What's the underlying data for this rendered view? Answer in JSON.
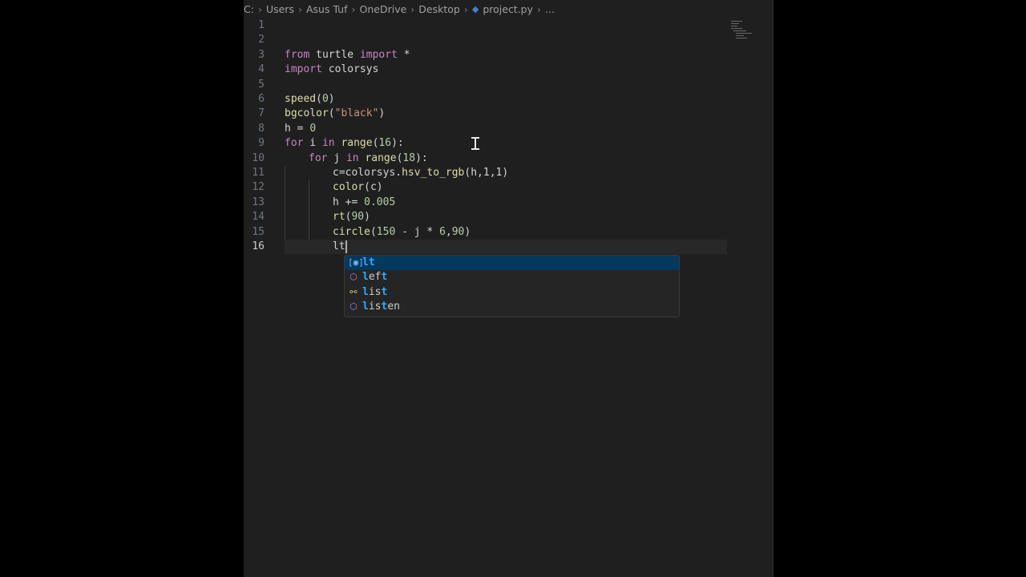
{
  "breadcrumb": {
    "parts": [
      "C:",
      "Users",
      "Asus Tuf",
      "OneDrive",
      "Desktop"
    ],
    "file": "project.py",
    "ellipsis": "..."
  },
  "gutter": {
    "line_numbers": [
      "1",
      "2",
      "3",
      "4",
      "5",
      "6",
      "7",
      "8",
      "9",
      "10",
      "11",
      "12",
      "13",
      "14",
      "15",
      "16"
    ],
    "active_line": "16"
  },
  "code": {
    "l3_kw1": "from",
    "l3_mod": " turtle ",
    "l3_kw2": "import",
    "l3_rest": " *",
    "l4_kw": "import",
    "l4_mod": " colorsys",
    "l6_fn": "speed",
    "l6_open": "(",
    "l6_num": "0",
    "l6_close": ")",
    "l7_fn": "bgcolor",
    "l7_open": "(",
    "l7_str": "\"black\"",
    "l7_close": ")",
    "l8_var": "h",
    "l8_op": " = ",
    "l8_num": "0",
    "l9_kw1": "for",
    "l9_var": " i ",
    "l9_kw2": "in",
    "l9_fn": " range",
    "l9_open": "(",
    "l9_num": "16",
    "l9_close": "):",
    "l10_kw1": "for",
    "l10_var": " j ",
    "l10_kw2": "in",
    "l10_fn": " range",
    "l10_open": "(",
    "l10_num": "18",
    "l10_close": "):",
    "l11_var": "c",
    "l11_op": "=",
    "l11_mod": "colorsys.",
    "l11_fn": "hsv_to_rgb",
    "l11_args": "(h,1,1)",
    "l12_fn": "color",
    "l12_args": "(c)",
    "l13_var": "h",
    "l13_op": " += ",
    "l13_num": "0.005",
    "l14_fn": "rt",
    "l14_open": "(",
    "l14_num": "90",
    "l14_close": ")",
    "l15_fn": "circle",
    "l15_open": "(",
    "l15_num1": "150",
    "l15_mid": " - j * ",
    "l15_num2": "6",
    "l15_sep": ",",
    "l15_num3": "90",
    "l15_close": ")",
    "l16_typed": "lt"
  },
  "suggestions": [
    {
      "match": "lt",
      "rest": "",
      "icon": "variable-icon"
    },
    {
      "match": "l",
      "rest": "ef",
      "match2": "t",
      "rest2": "",
      "icon": "module-icon"
    },
    {
      "match": "l",
      "rest": "is",
      "match2": "t",
      "rest2": "",
      "icon": "keyword-icon"
    },
    {
      "match": "l",
      "rest": "is",
      "match2": "t",
      "rest2": "en",
      "icon": "module-icon"
    }
  ],
  "colors": {
    "editor_bg": "#1f1f1f",
    "keyword": "#c586c0",
    "function": "#dcdcaa",
    "string": "#ce9178",
    "number": "#b5cea8",
    "suggest_selected": "#04395e"
  }
}
